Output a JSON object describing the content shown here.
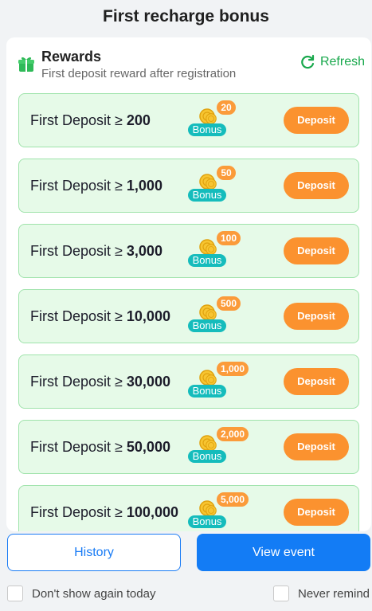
{
  "header": {
    "title": "First recharge bonus"
  },
  "rewards": {
    "title": "Rewards",
    "subtitle": "First deposit reward after registration",
    "refresh_label": "Refresh",
    "bonus_label": "Bonus",
    "deposit_label": "Deposit",
    "tier_prefix": "First Deposit ≥ ",
    "tiers": [
      {
        "threshold": "200",
        "bonus": "20"
      },
      {
        "threshold": "1,000",
        "bonus": "50"
      },
      {
        "threshold": "3,000",
        "bonus": "100"
      },
      {
        "threshold": "10,000",
        "bonus": "500"
      },
      {
        "threshold": "30,000",
        "bonus": "1,000"
      },
      {
        "threshold": "50,000",
        "bonus": "2,000"
      },
      {
        "threshold": "100,000",
        "bonus": "5,000"
      }
    ]
  },
  "footer": {
    "history_label": "History",
    "view_event_label": "View event",
    "dont_show_today": "Don't show again today",
    "never_remind": "Never remind"
  },
  "colors": {
    "accent_green": "#18a84c",
    "tier_bg": "#e6fae8",
    "deposit_orange": "#fb922f",
    "bonus_teal": "#15bcbc",
    "primary_blue": "#137cf5"
  }
}
